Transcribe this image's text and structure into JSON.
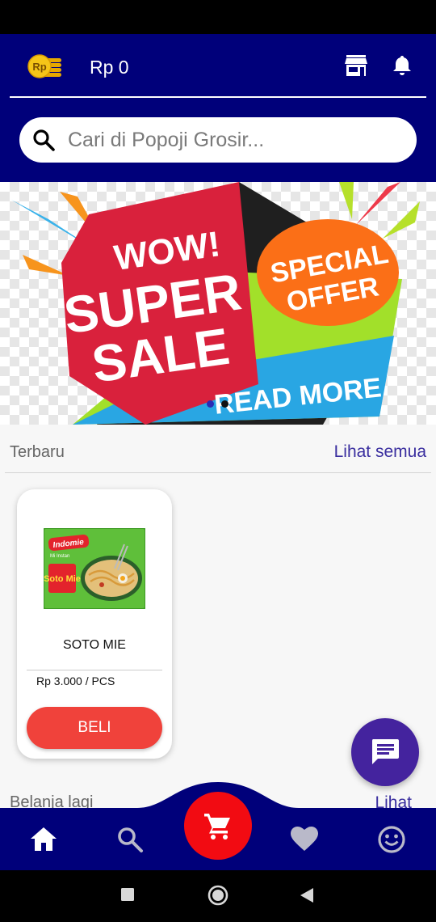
{
  "header": {
    "balance": "Rp 0",
    "coin_icon_text": "Rp",
    "coin_icon": "coin-stack-icon",
    "store_icon": "store-icon",
    "bell_icon": "bell-icon"
  },
  "search": {
    "placeholder": "Cari di Popoji Grosir..."
  },
  "banner": {
    "line1": "WOW!",
    "line2": "SUPER",
    "line3": "SALE",
    "badge_line1": "SPECIAL",
    "badge_line2": "OFFER",
    "cta": "READ MORE",
    "slides": 2,
    "active_slide": 1
  },
  "latest": {
    "title": "Terbaru",
    "link": "Lihat semua"
  },
  "products": [
    {
      "name": "SOTO MIE",
      "price": "Rp 3.000 / PCS",
      "buy_label": "BELI",
      "image_brand_text": "Indomie",
      "image_subtitle": "Mi Instan",
      "image_flavor": "Soto Mie"
    }
  ],
  "second_section": {
    "title": "Belanja lagi",
    "link": "Lihat"
  },
  "bottom_nav": {
    "items": [
      "home-icon",
      "search-icon",
      "cart-icon",
      "heart-icon",
      "smiley-icon"
    ]
  },
  "colors": {
    "primary": "#00007a",
    "buy_button": "#f0423b",
    "cart_fab": "#f20b12",
    "chat_fab": "#44239e",
    "link": "#3a2e9f"
  }
}
